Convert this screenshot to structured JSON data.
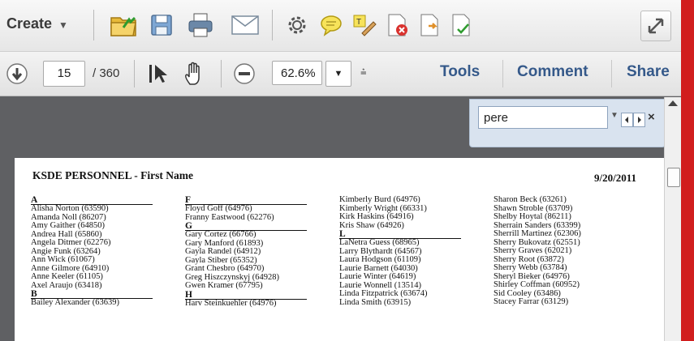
{
  "toolbar": {
    "create_label": "Create",
    "icons": [
      "open-folder-icon",
      "save-icon",
      "print-icon",
      "email-icon",
      "gear-icon",
      "comment-bubble-icon",
      "highlight-pen-icon",
      "pdf-delete-icon",
      "pdf-export-icon",
      "pdf-signed-icon",
      "expand-icon"
    ]
  },
  "nav": {
    "page_number": "15",
    "page_total": "/ 360",
    "zoom": "62.6%",
    "tools_label": "Tools",
    "comment_label": "Comment",
    "share_label": "Share"
  },
  "find": {
    "query": "pere"
  },
  "document": {
    "title": "KSDE PERSONNEL - First Name",
    "date": "9/20/2011",
    "columns": [
      {
        "sections": [
          {
            "letter": "A",
            "names": [
              "Alisha Norton (63590)",
              "Amanda Noll (86207)",
              "Amy Gaither (64850)",
              "Andrea Hall (65860)",
              "Angela Ditmer (62276)",
              "Angie Funk (63264)",
              "Ann Wick (61067)",
              "Anne Gilmore (64910)",
              "Anne Keeler (61105)",
              "Axel Araujo (63418)"
            ]
          },
          {
            "letter": "B",
            "names": [
              "Bailey Alexander (63639)"
            ]
          }
        ]
      },
      {
        "sections": [
          {
            "letter": "F",
            "names": [
              "Floyd Goff (64976)",
              "Franny Eastwood (62276)"
            ]
          },
          {
            "letter": "G",
            "names": [
              "Gary Cortez (66766)",
              "Gary Manford (61893)",
              "Gayla Randel (64912)",
              "Gayla Stiber (65352)",
              "Grant Chesbro (64970)",
              "Greg Hiszczynskyj (64928)",
              "Gwen Kramer (67795)"
            ]
          },
          {
            "letter": "H",
            "names": [
              "Harv Steinkuehler (64976)"
            ]
          }
        ]
      },
      {
        "sections": [
          {
            "letter": "",
            "names": [
              "Kimberly Burd (64976)",
              "Kimberly Wright (66331)",
              "Kirk Haskins (64916)",
              "Kris Shaw (64926)"
            ]
          },
          {
            "letter": "L",
            "names": [
              "LaNetra Guess (68965)",
              "Larry Blythardt (64567)",
              "Laura Hodgson (61109)",
              "Laurie Barnett (64030)",
              "Laurie Winter (64619)",
              "Laurie Wonnell (13514)",
              "Linda Fitzpatrick (63674)",
              "Linda Smith (63915)"
            ]
          }
        ]
      },
      {
        "sections": [
          {
            "letter": "",
            "names": [
              "Sharon Beck (63261)",
              "Shawn Stroble (63709)",
              "Shelby Hoytal (86211)",
              "Sherrain Sanders (63399)",
              "Sherrill Martinez (62306)",
              "Sherry Bukovatz (62551)",
              "Sherry Graves (62021)",
              "Sherry Root (63872)",
              "Sherry Webb (63784)",
              "Sheryl Bieker (64976)",
              "Shirley Coffman (60952)",
              "Sid Cooley (63486)",
              "Stacey Farrar (63129)"
            ]
          }
        ]
      }
    ]
  },
  "colors": {
    "accent": "#35598a",
    "sidebar_red": "#d11d1d",
    "find_bg": "#d9e3ef"
  }
}
